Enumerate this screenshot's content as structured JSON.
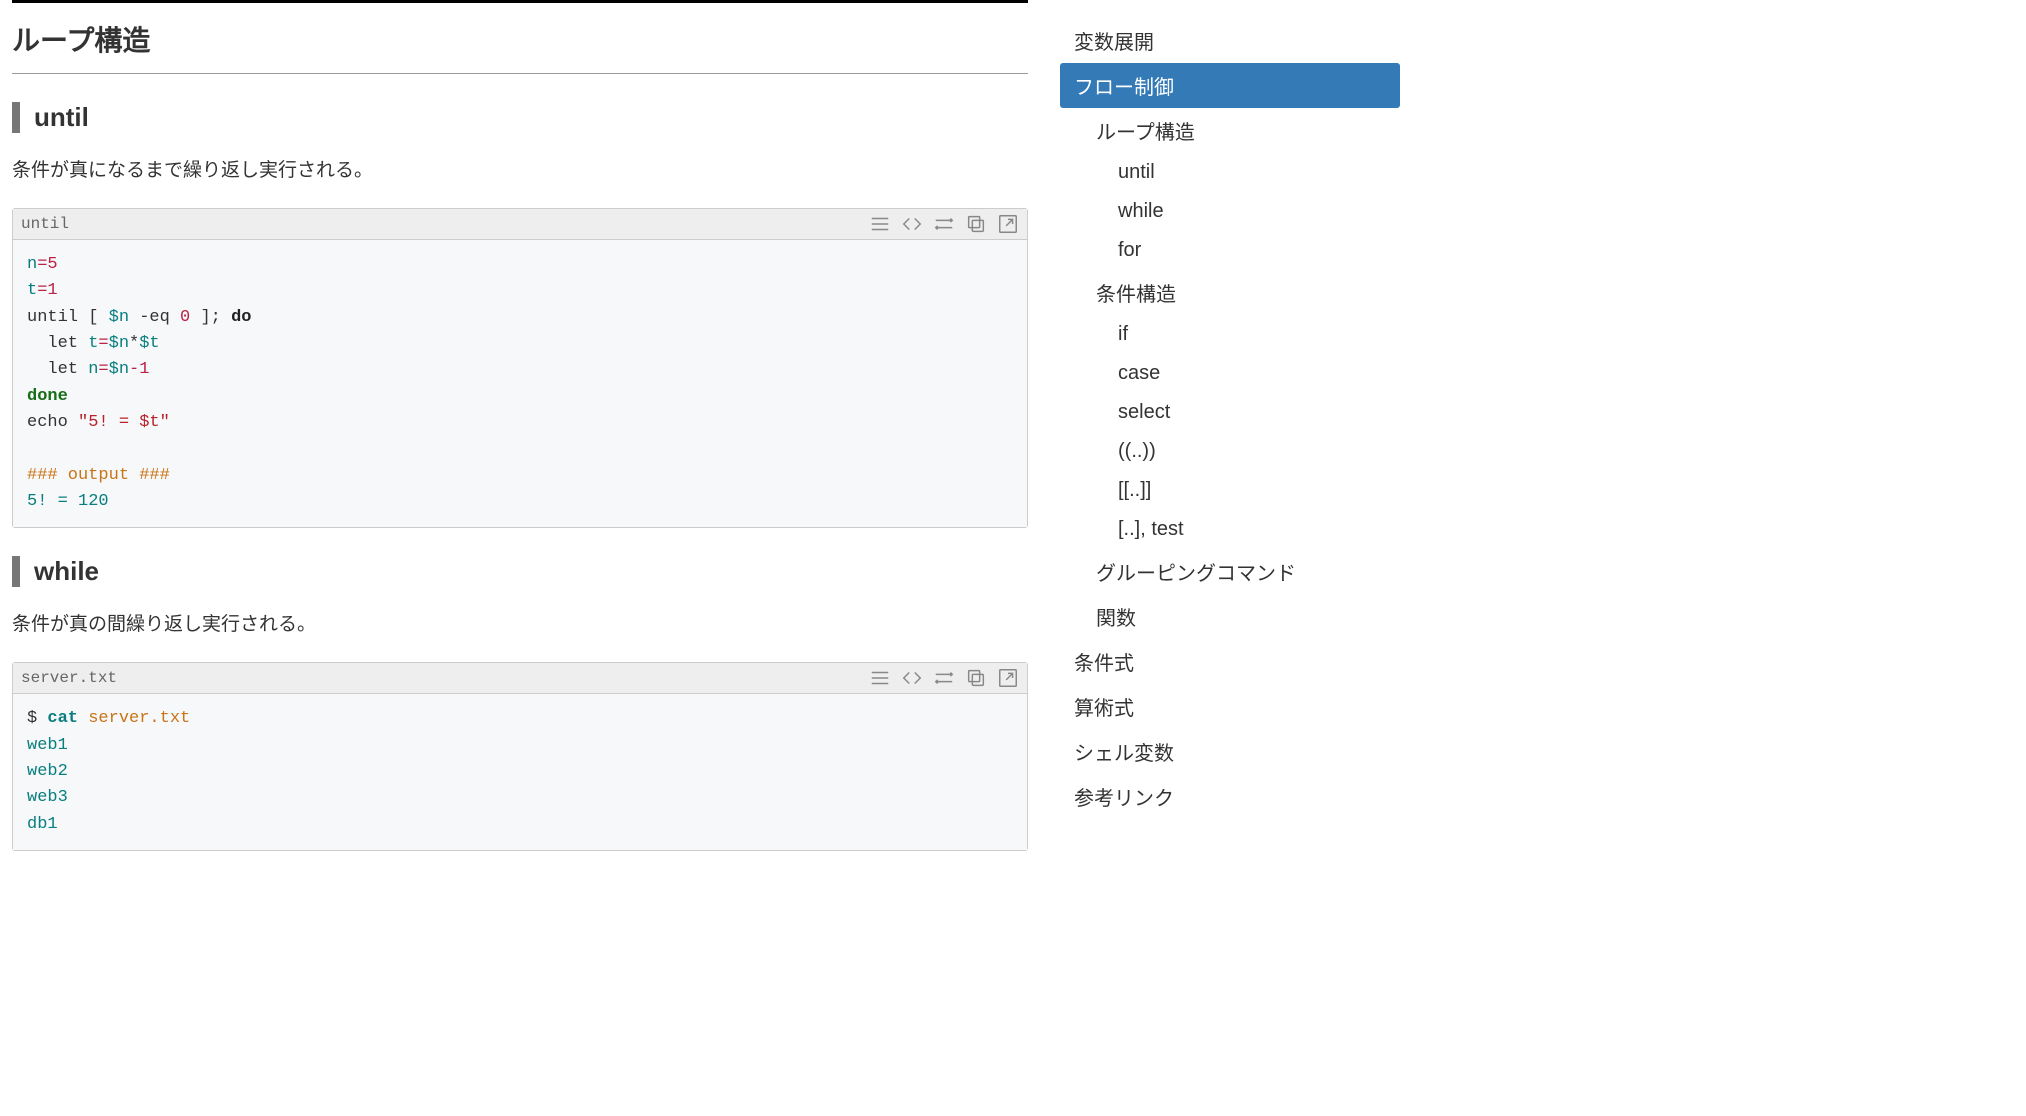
{
  "main": {
    "section_title": "ループ構造",
    "until": {
      "heading": "until",
      "desc": "条件が真になるまで繰り返し実行される。",
      "code_title": "until",
      "code": {
        "l1_var": "n",
        "l1_eq": "=",
        "l1_lit": "5",
        "l2_var": "t",
        "l2_eq": "=",
        "l2_lit": "1",
        "l3_a": "until [ ",
        "l3_v1": "$n",
        "l3_b": " -eq ",
        "l3_n": "0",
        "l3_c": " ]; ",
        "l3_kw": "do",
        "l4_a": "  let ",
        "l4_v": "t",
        "l4_eq": "=",
        "l4_r1": "$n",
        "l4_star": "*",
        "l4_r2": "$t",
        "l5_a": "  let ",
        "l5_v": "n",
        "l5_eq": "=",
        "l5_r1": "$n",
        "l5_minus": "-",
        "l5_n": "1",
        "l6_done": "done",
        "l7_a": "echo ",
        "l7_s": "\"5! = $t\"",
        "l9_cmt": "### output ###",
        "l10_out": "5! = 120"
      }
    },
    "while": {
      "heading": "while",
      "desc": "条件が真の間繰り返し実行される。",
      "code_title": "server.txt",
      "code": {
        "p": "$ ",
        "cmd": "cat",
        "sp": " ",
        "file": "server.txt",
        "o1": "web1",
        "o2": "web2",
        "o3": "web3",
        "o4": "db1"
      }
    }
  },
  "toc": {
    "items": [
      {
        "label": "変数展開",
        "level": 1,
        "active": false
      },
      {
        "label": "フロー制御",
        "level": 1,
        "active": true
      },
      {
        "label": "ループ構造",
        "level": 2,
        "active": false
      },
      {
        "label": "until",
        "level": 3,
        "active": false
      },
      {
        "label": "while",
        "level": 3,
        "active": false
      },
      {
        "label": "for",
        "level": 3,
        "active": false
      },
      {
        "label": "条件構造",
        "level": 2,
        "active": false
      },
      {
        "label": "if",
        "level": 3,
        "active": false
      },
      {
        "label": "case",
        "level": 3,
        "active": false
      },
      {
        "label": "select",
        "level": 3,
        "active": false
      },
      {
        "label": "((..))",
        "level": 3,
        "active": false
      },
      {
        "label": "[[..]]",
        "level": 3,
        "active": false
      },
      {
        "label": "[..], test",
        "level": 3,
        "active": false
      },
      {
        "label": "グルーピングコマンド",
        "level": 2,
        "active": false
      },
      {
        "label": "関数",
        "level": 2,
        "active": false
      },
      {
        "label": "条件式",
        "level": 1,
        "active": false
      },
      {
        "label": "算術式",
        "level": 1,
        "active": false
      },
      {
        "label": "シェル変数",
        "level": 1,
        "active": false
      },
      {
        "label": "参考リンク",
        "level": 1,
        "active": false
      }
    ]
  },
  "tools": {
    "lines": "lines-icon",
    "code": "code-icon",
    "wrap": "wrap-icon",
    "copy": "copy-icon",
    "open": "open-new-icon"
  }
}
